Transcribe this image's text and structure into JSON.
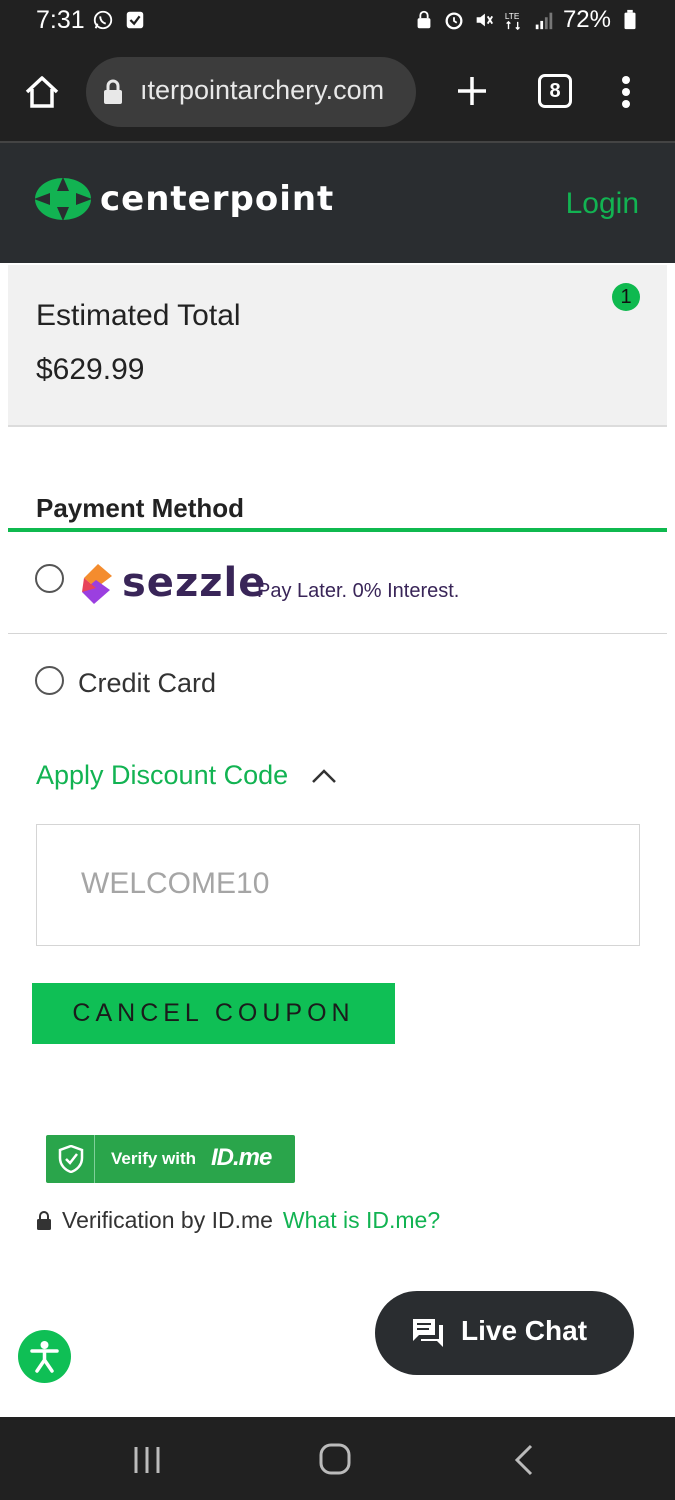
{
  "status_bar": {
    "time": "7:31",
    "battery": "72%",
    "icons": [
      "whatsapp-icon",
      "download-icon",
      "lock-icon",
      "alarm-icon",
      "mute-icon",
      "lte-icon",
      "signal-icon",
      "battery-icon"
    ]
  },
  "browser": {
    "url": "ıterpointarchery.com",
    "tab_count": "8"
  },
  "header": {
    "brand": "centerpoint",
    "login_label": "Login",
    "colors": {
      "accent": "#12b352",
      "header_bg": "#2a2d30"
    }
  },
  "summary": {
    "label": "Estimated Total",
    "total": "$629.99",
    "cart_count": "1"
  },
  "payment": {
    "heading": "Payment Method",
    "options": [
      {
        "brand": "sezzle",
        "tagline": "Pay Later. 0% Interest.",
        "selected": false
      },
      {
        "label": "Credit Card",
        "selected": false
      }
    ]
  },
  "discount": {
    "toggle_label": "Apply Discount Code",
    "code_value": "WELCOME10",
    "cancel_label": "CANCEL COUPON"
  },
  "idme": {
    "button_text": "Verify with",
    "brand": "ID.me",
    "verification_text": "Verification by ID.me",
    "what_link": "What is ID.me?"
  },
  "chat": {
    "label": "Live Chat"
  }
}
